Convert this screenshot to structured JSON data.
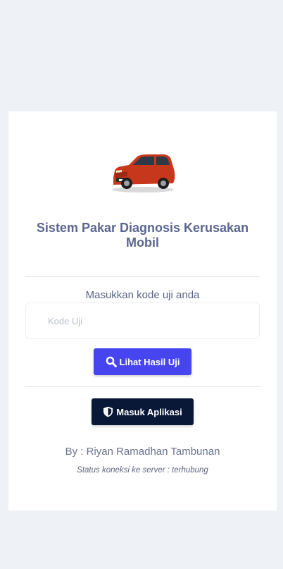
{
  "app": {
    "title": "Sistem Pakar Diagnosis Kerusakan Mobil",
    "logo_icon": "car-image-icon"
  },
  "form": {
    "prompt": "Masukkan kode uji anda",
    "code_input": {
      "placeholder": "Kode Uji",
      "value": ""
    },
    "submit_label": "Lihat Hasil Uji",
    "submit_icon": "search-icon"
  },
  "app_login": {
    "label": "Masuk Aplikasi",
    "icon": "shield-icon"
  },
  "footer": {
    "author": "By : Riyan Ramadhan Tambunan",
    "status": "Status koneksi ke server : terhubung"
  },
  "colors": {
    "background": "#eef1f5",
    "title": "#5c6690",
    "primary_button": "#4645f0",
    "dark_button": "#0a1838",
    "car": "#c7371c"
  }
}
